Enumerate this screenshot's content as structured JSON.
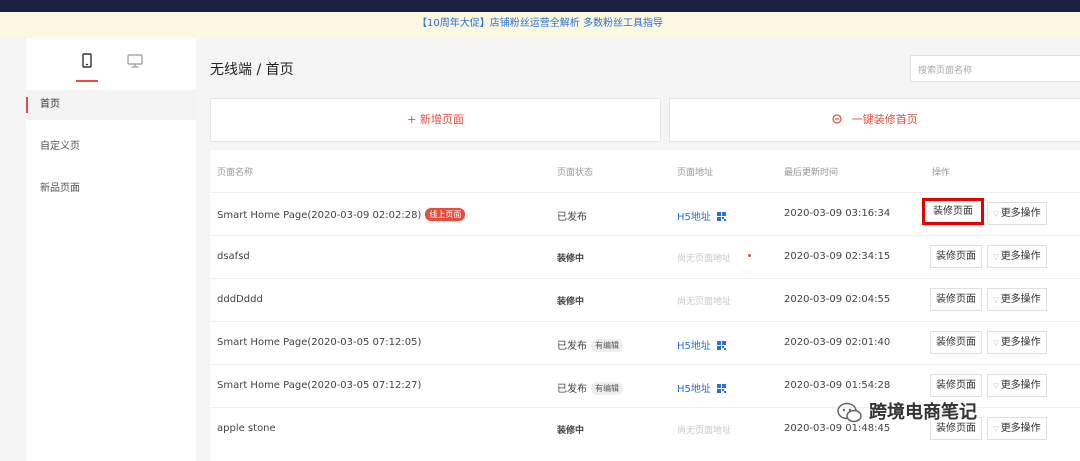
{
  "promo": {
    "text": "【10周年大促】店铺粉丝运营全解析 多数粉丝工具指导"
  },
  "sidebar": {
    "tabs": [
      {
        "icon": "mobile-icon"
      },
      {
        "icon": "desktop-icon"
      }
    ],
    "items": [
      {
        "label": "首页",
        "active": true
      },
      {
        "label": "自定义页"
      },
      {
        "label": "新品页面"
      }
    ]
  },
  "header": {
    "breadcrumb": "无线端 / 首页"
  },
  "search": {
    "placeholder": "搜索页面名称"
  },
  "actions": {
    "add_label": "+ 新增页面",
    "decorate_label": "一键装修首页",
    "decorate_icon": "decorate-icon"
  },
  "table": {
    "columns": [
      "页面名称",
      "页面状态",
      "页面地址",
      "最后更新时间",
      "操作"
    ],
    "rows": [
      {
        "name": "Smart Home Page(2020-03-09 02:02:28)",
        "badge": "线上页面",
        "status": "已发布",
        "address": "H5地址",
        "has_qr": true,
        "updated": "2020-03-09 03:16:34",
        "decorate": "装修页面",
        "more": "更多操作",
        "highlight": true
      },
      {
        "name": "dsafsd",
        "status": "装修中",
        "address": "尚无页面地址",
        "updated": "2020-03-09 02:34:15",
        "decorate": "装修页面",
        "more": "更多操作"
      },
      {
        "name": "dddDddd",
        "status": "装修中",
        "address": "尚无页面地址",
        "updated": "2020-03-09 02:04:55",
        "decorate": "装修页面",
        "more": "更多操作"
      },
      {
        "name": "Smart Home Page(2020-03-05 07:12:05)",
        "status": "已发布",
        "status_badge": "有编辑",
        "address": "H5地址",
        "has_qr": true,
        "updated": "2020-03-09 02:01:40",
        "decorate": "装修页面",
        "more": "更多操作"
      },
      {
        "name": "Smart Home Page(2020-03-05 07:12:27)",
        "status": "已发布",
        "status_badge": "有编辑",
        "address": "H5地址",
        "has_qr": true,
        "updated": "2020-03-09 01:54:28",
        "decorate": "装修页面",
        "more": "更多操作"
      },
      {
        "name": "apple stone",
        "status": "装修中",
        "address": "尚无页面地址",
        "updated": "2020-03-09 01:48:45",
        "decorate": "装修页面",
        "more": "更多操作"
      }
    ]
  },
  "watermark": {
    "text": "跨境电商笔记"
  },
  "colors": {
    "accent": "#e74c3c",
    "link": "#2a6fd6",
    "topbar": "#1b2240",
    "promo_bg": "#fdf8e1",
    "highlight_border": "#e60000"
  }
}
